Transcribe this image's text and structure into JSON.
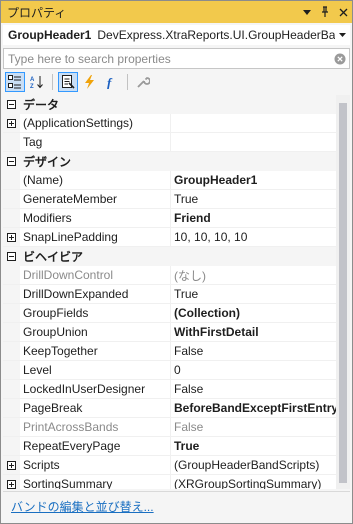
{
  "window": {
    "title": "プロパティ",
    "buttons": {
      "dropdown": "▾",
      "pin": "⊥",
      "close": "✕"
    }
  },
  "selector": {
    "name": "GroupHeader1",
    "type": "DevExpress.XtraReports.UI.GroupHeaderBand",
    "dropdown": "▾"
  },
  "search": {
    "placeholder": "Type here to search properties",
    "value": ""
  },
  "toolbar": {
    "active_tool": "properties-view",
    "accent_color": "#3399ff",
    "event_color": "#f0a30a",
    "expression_color": "#1a5fc1"
  },
  "grid": {
    "rows": [
      {
        "kind": "category",
        "expander": "minus",
        "name": "データ"
      },
      {
        "kind": "prop",
        "expander": "plus",
        "name": "(ApplicationSettings)",
        "value": ""
      },
      {
        "kind": "prop",
        "expander": "",
        "name": "Tag",
        "value": ""
      },
      {
        "kind": "category",
        "expander": "minus",
        "name": "デザイン"
      },
      {
        "kind": "prop",
        "expander": "",
        "name": "(Name)",
        "value": "GroupHeader1",
        "bold": true
      },
      {
        "kind": "prop",
        "expander": "",
        "name": "GenerateMember",
        "value": "True"
      },
      {
        "kind": "prop",
        "expander": "",
        "name": "Modifiers",
        "value": "Friend",
        "bold": true
      },
      {
        "kind": "prop",
        "expander": "plus",
        "name": "SnapLinePadding",
        "value": "10, 10, 10, 10"
      },
      {
        "kind": "category",
        "expander": "minus",
        "name": "ビヘイビア"
      },
      {
        "kind": "prop",
        "expander": "",
        "name": "DrillDownControl",
        "value": "(なし)",
        "readonly": true
      },
      {
        "kind": "prop",
        "expander": "",
        "name": "DrillDownExpanded",
        "value": "True"
      },
      {
        "kind": "prop",
        "expander": "",
        "name": "GroupFields",
        "value": "(Collection)",
        "bold": true
      },
      {
        "kind": "prop",
        "expander": "",
        "name": "GroupUnion",
        "value": "WithFirstDetail",
        "bold": true
      },
      {
        "kind": "prop",
        "expander": "",
        "name": "KeepTogether",
        "value": "False"
      },
      {
        "kind": "prop",
        "expander": "",
        "name": "Level",
        "value": "0"
      },
      {
        "kind": "prop",
        "expander": "",
        "name": "LockedInUserDesigner",
        "value": "False"
      },
      {
        "kind": "prop",
        "expander": "",
        "name": "PageBreak",
        "value": "BeforeBandExceptFirstEntry",
        "bold": true
      },
      {
        "kind": "prop",
        "expander": "",
        "name": "PrintAcrossBands",
        "value": "False",
        "readonly": true
      },
      {
        "kind": "prop",
        "expander": "",
        "name": "RepeatEveryPage",
        "value": "True",
        "bold": true
      },
      {
        "kind": "prop",
        "expander": "plus",
        "name": "Scripts",
        "value": "(GroupHeaderBandScripts)"
      },
      {
        "kind": "prop",
        "expander": "plus",
        "name": "SortingSummary",
        "value": "(XRGroupSortingSummary)"
      }
    ]
  },
  "footer": {
    "link": "バンドの編集と並び替え..."
  }
}
